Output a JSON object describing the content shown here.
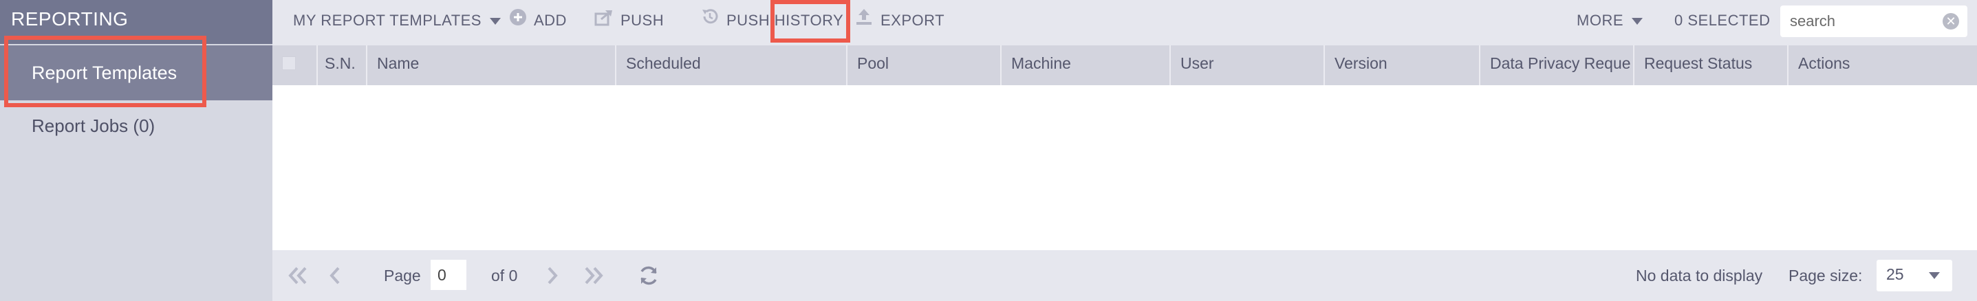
{
  "sidebar": {
    "title": "REPORTING",
    "items": [
      {
        "label": "Report Templates",
        "active": true
      },
      {
        "label": "Report Jobs (0)",
        "active": false
      }
    ]
  },
  "toolbar": {
    "templates_dropdown": "MY REPORT TEMPLATES",
    "add": "ADD",
    "push": "PUSH",
    "push_history": "PUSH HISTORY",
    "export": "EXPORT",
    "more": "MORE",
    "selected": "0 SELECTED",
    "search_placeholder": "search",
    "clear_icon": "✕"
  },
  "grid": {
    "columns": [
      "S.N.",
      "Name",
      "Scheduled",
      "Pool",
      "Machine",
      "User",
      "Version",
      "Data Privacy Reque",
      "Request Status",
      "Actions"
    ],
    "rows": []
  },
  "pager": {
    "page_label": "Page",
    "page_value": "0",
    "of_label": "of 0",
    "no_data": "No data to display",
    "page_size_label": "Page size:",
    "page_size_value": "25"
  },
  "colors": {
    "accent_highlight": "#ed5a4c",
    "sidebar_header": "#727690",
    "sidebar_active": "#7e8199",
    "sidebar_bg": "#d6d8e2",
    "toolbar_bg": "#e6e7ee",
    "grid_header_bg": "#d3d4de"
  }
}
